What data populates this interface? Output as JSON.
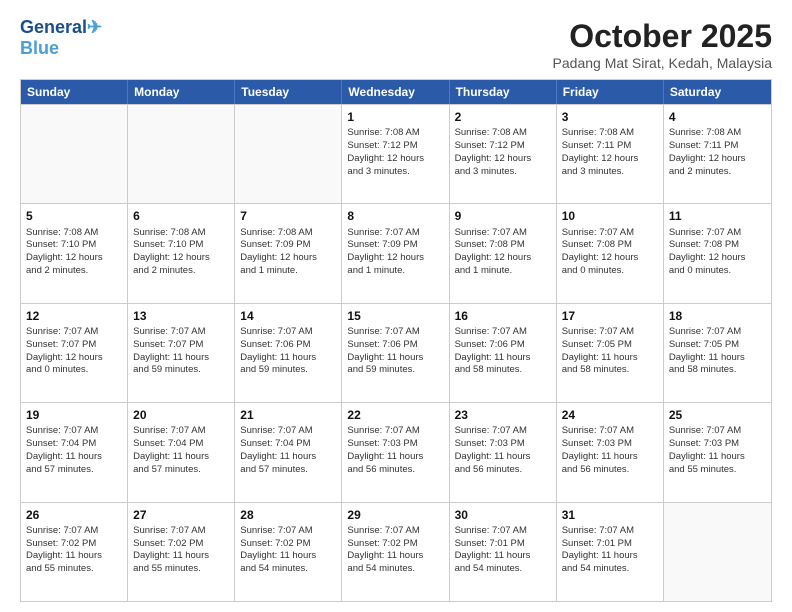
{
  "header": {
    "logo_line1": "General",
    "logo_line2": "Blue",
    "month_title": "October 2025",
    "location": "Padang Mat Sirat, Kedah, Malaysia"
  },
  "days_of_week": [
    "Sunday",
    "Monday",
    "Tuesday",
    "Wednesday",
    "Thursday",
    "Friday",
    "Saturday"
  ],
  "weeks": [
    [
      {
        "day": "",
        "info": "",
        "empty": true
      },
      {
        "day": "",
        "info": "",
        "empty": true
      },
      {
        "day": "",
        "info": "",
        "empty": true
      },
      {
        "day": "1",
        "info": "Sunrise: 7:08 AM\nSunset: 7:12 PM\nDaylight: 12 hours\nand 3 minutes.",
        "empty": false
      },
      {
        "day": "2",
        "info": "Sunrise: 7:08 AM\nSunset: 7:12 PM\nDaylight: 12 hours\nand 3 minutes.",
        "empty": false
      },
      {
        "day": "3",
        "info": "Sunrise: 7:08 AM\nSunset: 7:11 PM\nDaylight: 12 hours\nand 3 minutes.",
        "empty": false
      },
      {
        "day": "4",
        "info": "Sunrise: 7:08 AM\nSunset: 7:11 PM\nDaylight: 12 hours\nand 2 minutes.",
        "empty": false
      }
    ],
    [
      {
        "day": "5",
        "info": "Sunrise: 7:08 AM\nSunset: 7:10 PM\nDaylight: 12 hours\nand 2 minutes.",
        "empty": false
      },
      {
        "day": "6",
        "info": "Sunrise: 7:08 AM\nSunset: 7:10 PM\nDaylight: 12 hours\nand 2 minutes.",
        "empty": false
      },
      {
        "day": "7",
        "info": "Sunrise: 7:08 AM\nSunset: 7:09 PM\nDaylight: 12 hours\nand 1 minute.",
        "empty": false
      },
      {
        "day": "8",
        "info": "Sunrise: 7:07 AM\nSunset: 7:09 PM\nDaylight: 12 hours\nand 1 minute.",
        "empty": false
      },
      {
        "day": "9",
        "info": "Sunrise: 7:07 AM\nSunset: 7:08 PM\nDaylight: 12 hours\nand 1 minute.",
        "empty": false
      },
      {
        "day": "10",
        "info": "Sunrise: 7:07 AM\nSunset: 7:08 PM\nDaylight: 12 hours\nand 0 minutes.",
        "empty": false
      },
      {
        "day": "11",
        "info": "Sunrise: 7:07 AM\nSunset: 7:08 PM\nDaylight: 12 hours\nand 0 minutes.",
        "empty": false
      }
    ],
    [
      {
        "day": "12",
        "info": "Sunrise: 7:07 AM\nSunset: 7:07 PM\nDaylight: 12 hours\nand 0 minutes.",
        "empty": false
      },
      {
        "day": "13",
        "info": "Sunrise: 7:07 AM\nSunset: 7:07 PM\nDaylight: 11 hours\nand 59 minutes.",
        "empty": false
      },
      {
        "day": "14",
        "info": "Sunrise: 7:07 AM\nSunset: 7:06 PM\nDaylight: 11 hours\nand 59 minutes.",
        "empty": false
      },
      {
        "day": "15",
        "info": "Sunrise: 7:07 AM\nSunset: 7:06 PM\nDaylight: 11 hours\nand 59 minutes.",
        "empty": false
      },
      {
        "day": "16",
        "info": "Sunrise: 7:07 AM\nSunset: 7:06 PM\nDaylight: 11 hours\nand 58 minutes.",
        "empty": false
      },
      {
        "day": "17",
        "info": "Sunrise: 7:07 AM\nSunset: 7:05 PM\nDaylight: 11 hours\nand 58 minutes.",
        "empty": false
      },
      {
        "day": "18",
        "info": "Sunrise: 7:07 AM\nSunset: 7:05 PM\nDaylight: 11 hours\nand 58 minutes.",
        "empty": false
      }
    ],
    [
      {
        "day": "19",
        "info": "Sunrise: 7:07 AM\nSunset: 7:04 PM\nDaylight: 11 hours\nand 57 minutes.",
        "empty": false
      },
      {
        "day": "20",
        "info": "Sunrise: 7:07 AM\nSunset: 7:04 PM\nDaylight: 11 hours\nand 57 minutes.",
        "empty": false
      },
      {
        "day": "21",
        "info": "Sunrise: 7:07 AM\nSunset: 7:04 PM\nDaylight: 11 hours\nand 57 minutes.",
        "empty": false
      },
      {
        "day": "22",
        "info": "Sunrise: 7:07 AM\nSunset: 7:03 PM\nDaylight: 11 hours\nand 56 minutes.",
        "empty": false
      },
      {
        "day": "23",
        "info": "Sunrise: 7:07 AM\nSunset: 7:03 PM\nDaylight: 11 hours\nand 56 minutes.",
        "empty": false
      },
      {
        "day": "24",
        "info": "Sunrise: 7:07 AM\nSunset: 7:03 PM\nDaylight: 11 hours\nand 56 minutes.",
        "empty": false
      },
      {
        "day": "25",
        "info": "Sunrise: 7:07 AM\nSunset: 7:03 PM\nDaylight: 11 hours\nand 55 minutes.",
        "empty": false
      }
    ],
    [
      {
        "day": "26",
        "info": "Sunrise: 7:07 AM\nSunset: 7:02 PM\nDaylight: 11 hours\nand 55 minutes.",
        "empty": false
      },
      {
        "day": "27",
        "info": "Sunrise: 7:07 AM\nSunset: 7:02 PM\nDaylight: 11 hours\nand 55 minutes.",
        "empty": false
      },
      {
        "day": "28",
        "info": "Sunrise: 7:07 AM\nSunset: 7:02 PM\nDaylight: 11 hours\nand 54 minutes.",
        "empty": false
      },
      {
        "day": "29",
        "info": "Sunrise: 7:07 AM\nSunset: 7:02 PM\nDaylight: 11 hours\nand 54 minutes.",
        "empty": false
      },
      {
        "day": "30",
        "info": "Sunrise: 7:07 AM\nSunset: 7:01 PM\nDaylight: 11 hours\nand 54 minutes.",
        "empty": false
      },
      {
        "day": "31",
        "info": "Sunrise: 7:07 AM\nSunset: 7:01 PM\nDaylight: 11 hours\nand 54 minutes.",
        "empty": false
      },
      {
        "day": "",
        "info": "",
        "empty": true
      }
    ]
  ]
}
